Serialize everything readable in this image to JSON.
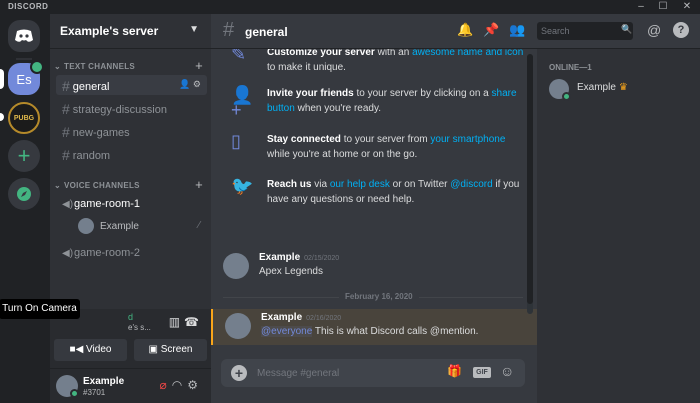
{
  "window": {
    "brand": "DISCORD",
    "minimize": "–",
    "maximize": "☐",
    "close": "✕"
  },
  "guilds": {
    "server_initials": "Es",
    "pubg_label": "PUBG",
    "add_label": "+",
    "explore_label": "◉"
  },
  "server": {
    "name": "Example's server"
  },
  "sidebar": {
    "text_category": "TEXT CHANNELS",
    "voice_category": "VOICE CHANNELS",
    "text_channels": [
      "general",
      "strategy-discussion",
      "new-games",
      "random"
    ],
    "voice_channels": [
      "game-room-1",
      "game-room-2"
    ],
    "voice_user": "Example"
  },
  "voice_panel": {
    "status": "d",
    "sub": "e's s...",
    "tooltip": "Turn On Camera",
    "video_label": "Video",
    "screen_label": "Screen"
  },
  "user": {
    "name": "Example",
    "tag": "#3701"
  },
  "header": {
    "channel": "general",
    "search_placeholder": "Search"
  },
  "tips": [
    {
      "bold": "Customize your server",
      "pre": " with an ",
      "link": "awesome name and icon",
      "post": " to make it unique."
    },
    {
      "bold": "Invite your friends",
      "pre": " to your server by clicking on a ",
      "link": "share button",
      "post": " when you're ready."
    },
    {
      "bold": "Stay connected",
      "pre": " to your server from ",
      "link": "your smartphone",
      "post": " while you're at home or on the go."
    },
    {
      "bold": "Reach us",
      "pre": " via ",
      "link": "our help desk",
      "mid": " or on Twitter ",
      "link2": "@discord",
      "post": " if you have any questions or need help."
    }
  ],
  "messages": [
    {
      "author": "Example",
      "timestamp": "02/15/2020",
      "text": "Apex Legends"
    },
    {
      "author": "Example",
      "timestamp": "02/16/2020",
      "mention": "@everyone",
      "text": " This is what Discord calls @mention."
    }
  ],
  "date_divider": "February 16, 2020",
  "composer": {
    "placeholder": "Message #general",
    "gif_label": "GIF"
  },
  "members": {
    "heading": "ONLINE—1",
    "name": "Example"
  },
  "colors": {
    "blurple": "#7289da",
    "green": "#43b581",
    "link": "#00b0f4",
    "mention_bar": "#faa61a"
  }
}
